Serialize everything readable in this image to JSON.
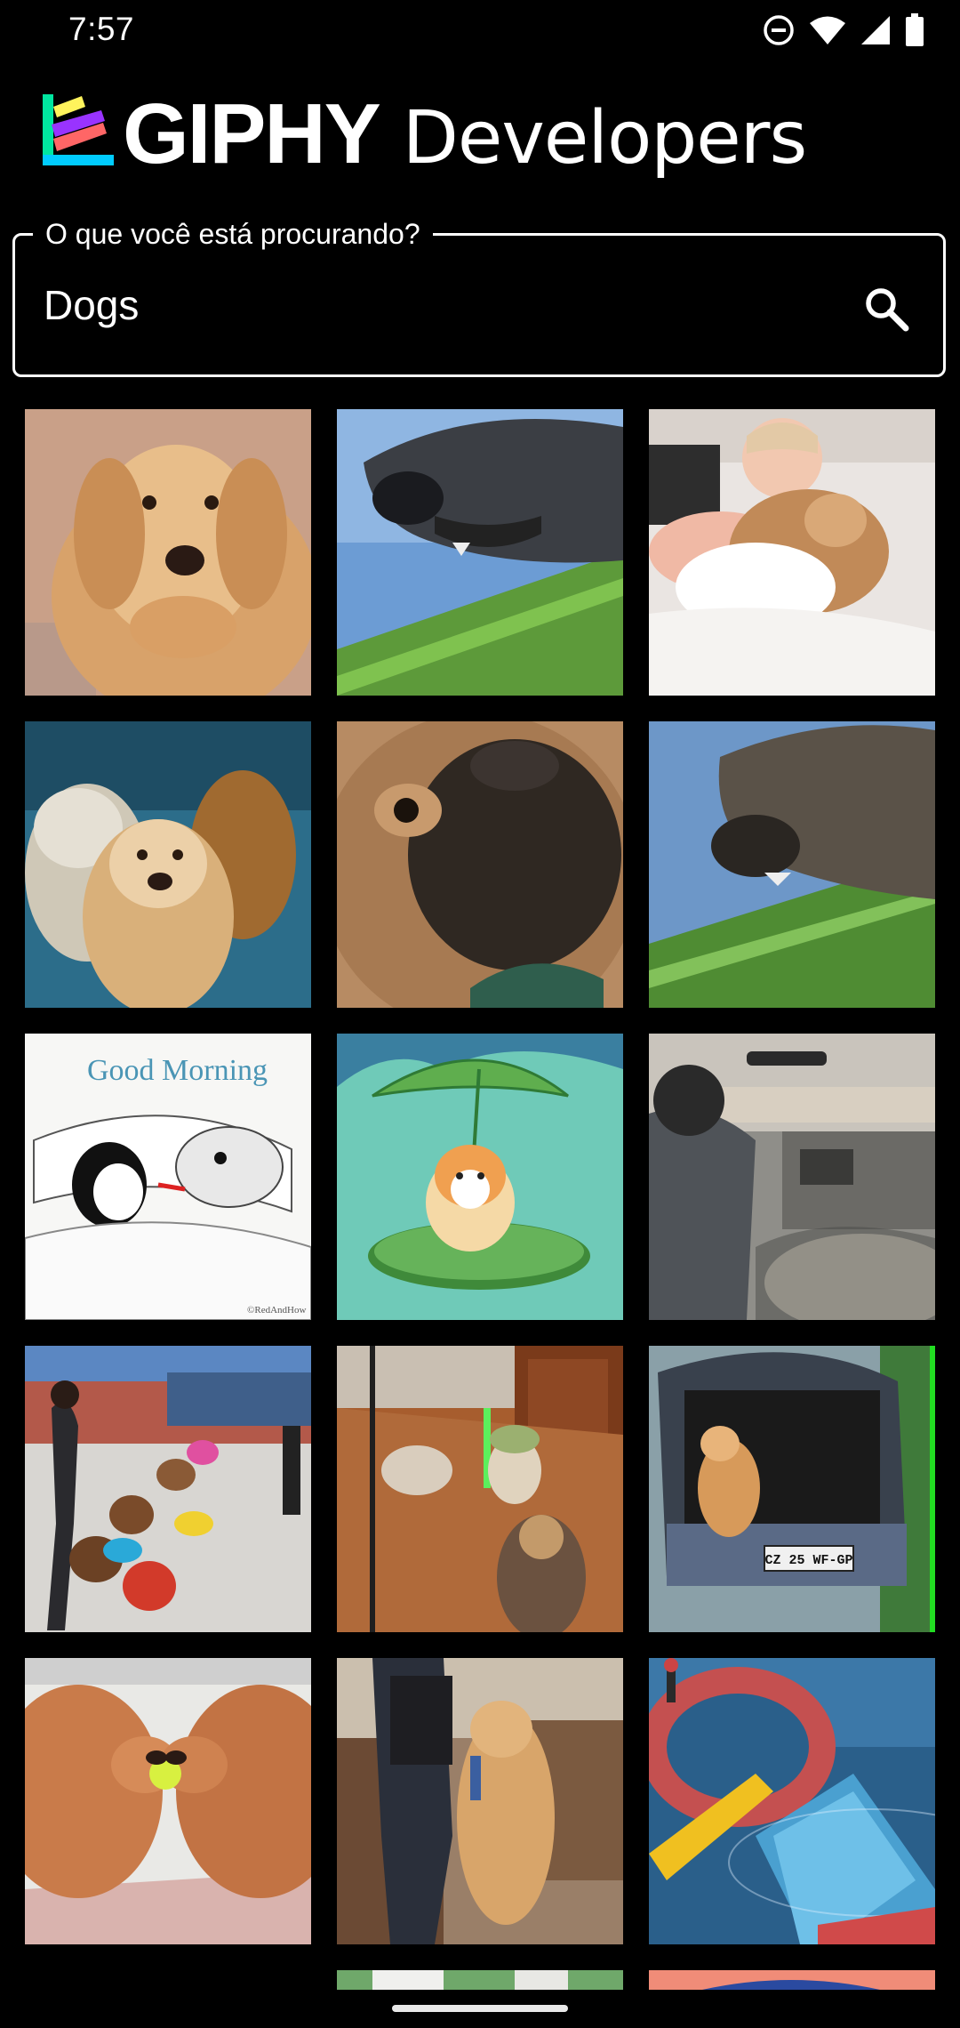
{
  "status_bar": {
    "time": "7:57",
    "icons": [
      "do-not-disturb-icon",
      "wifi-icon",
      "signal-icon",
      "battery-icon"
    ]
  },
  "header": {
    "brand": "GIPHY",
    "sub": "Developers",
    "logo_icon": "giphy-logo-icon"
  },
  "search": {
    "label": "O que você está procurando?",
    "value": "Dogs",
    "icon": "search-icon"
  },
  "colors": {
    "background": "#000000",
    "text": "#ffffff",
    "logo_green": "#00e6a0",
    "logo_purple": "#9933ff",
    "logo_yellow": "#fff35c",
    "logo_red": "#ff6666",
    "logo_blue": "#00ccff"
  },
  "gifs": [
    {
      "name": "gif-golden-retriever"
    },
    {
      "name": "gif-dog-car-window"
    },
    {
      "name": "gif-baby-and-dog-bed"
    },
    {
      "name": "gif-three-dogs"
    },
    {
      "name": "gif-pug-closeup"
    },
    {
      "name": "gif-dog-car-window-2"
    },
    {
      "name": "gif-good-morning",
      "caption": "Good Morning",
      "credit": "©RedAndHow"
    },
    {
      "name": "gif-corgi-leaf"
    },
    {
      "name": "gif-dog-in-truck"
    },
    {
      "name": "gif-dancing-dogs"
    },
    {
      "name": "gif-yoda-dogs"
    },
    {
      "name": "gif-dog-car-trunk",
      "plate": "CZ 25 WF-GP"
    },
    {
      "name": "gif-dogs-tennis-ball"
    },
    {
      "name": "gif-dog-kitchen"
    },
    {
      "name": "gif-water-slide"
    },
    {
      "name": "gif-partial-1"
    },
    {
      "name": "gif-partial-2"
    }
  ]
}
